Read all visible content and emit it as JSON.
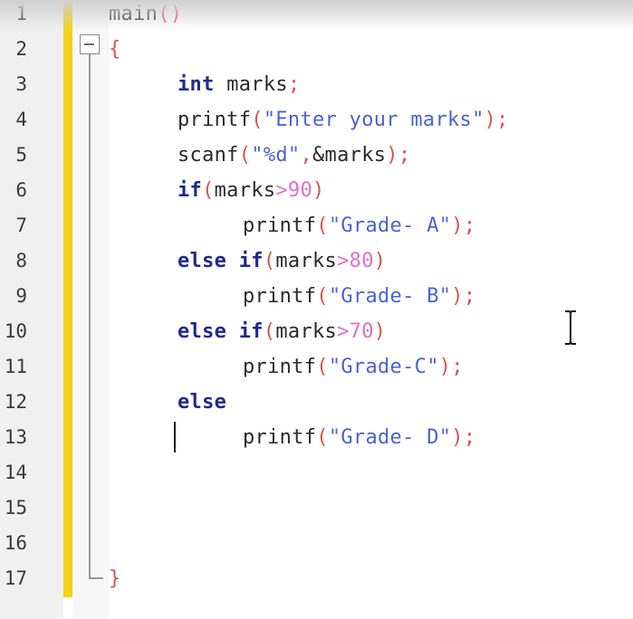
{
  "editor": {
    "line_numbers": [
      "1",
      "2",
      "3",
      "4",
      "5",
      "6",
      "7",
      "8",
      "9",
      "10",
      "11",
      "12",
      "13",
      "14",
      "15",
      "16",
      "17"
    ],
    "code": [
      {
        "line": "1",
        "tokens": [
          {
            "t": "id",
            "v": "main"
          },
          {
            "t": "punc",
            "v": "()"
          }
        ]
      },
      {
        "line": "2",
        "tokens": [
          {
            "t": "punc",
            "v": "{"
          }
        ]
      },
      {
        "line": "3",
        "tokens": [
          {
            "t": "kw",
            "v": "int "
          },
          {
            "t": "id",
            "v": "marks"
          },
          {
            "t": "punc",
            "v": ";"
          }
        ]
      },
      {
        "line": "4",
        "tokens": [
          {
            "t": "id",
            "v": "printf"
          },
          {
            "t": "punc",
            "v": "("
          },
          {
            "t": "str",
            "v": "\"Enter your marks\""
          },
          {
            "t": "punc",
            "v": ");"
          }
        ]
      },
      {
        "line": "5",
        "tokens": [
          {
            "t": "id",
            "v": "scanf"
          },
          {
            "t": "punc",
            "v": "("
          },
          {
            "t": "str",
            "v": "\"%d\""
          },
          {
            "t": "punc",
            "v": ","
          },
          {
            "t": "id",
            "v": "&marks"
          },
          {
            "t": "punc",
            "v": ");"
          }
        ]
      },
      {
        "line": "6",
        "tokens": [
          {
            "t": "kw",
            "v": "if"
          },
          {
            "t": "punc",
            "v": "("
          },
          {
            "t": "id",
            "v": "marks"
          },
          {
            "t": "op",
            "v": ">"
          },
          {
            "t": "num",
            "v": "90"
          },
          {
            "t": "punc",
            "v": ")"
          }
        ]
      },
      {
        "line": "7",
        "tokens": [
          {
            "t": "id",
            "v": "printf"
          },
          {
            "t": "punc",
            "v": "("
          },
          {
            "t": "str",
            "v": "\"Grade- A\""
          },
          {
            "t": "punc",
            "v": ");"
          }
        ]
      },
      {
        "line": "8",
        "tokens": [
          {
            "t": "kw",
            "v": "else if"
          },
          {
            "t": "punc",
            "v": "("
          },
          {
            "t": "id",
            "v": "marks"
          },
          {
            "t": "op",
            "v": ">"
          },
          {
            "t": "num",
            "v": "80"
          },
          {
            "t": "punc",
            "v": ")"
          }
        ]
      },
      {
        "line": "9",
        "tokens": [
          {
            "t": "id",
            "v": "printf"
          },
          {
            "t": "punc",
            "v": "("
          },
          {
            "t": "str",
            "v": "\"Grade- B\""
          },
          {
            "t": "punc",
            "v": ");"
          }
        ]
      },
      {
        "line": "10",
        "tokens": [
          {
            "t": "kw",
            "v": "else if"
          },
          {
            "t": "punc",
            "v": "("
          },
          {
            "t": "id",
            "v": "marks"
          },
          {
            "t": "op",
            "v": ">"
          },
          {
            "t": "num",
            "v": "70"
          },
          {
            "t": "punc",
            "v": ")"
          }
        ]
      },
      {
        "line": "11",
        "tokens": [
          {
            "t": "id",
            "v": "printf"
          },
          {
            "t": "punc",
            "v": "("
          },
          {
            "t": "str",
            "v": "\"Grade-C\""
          },
          {
            "t": "punc",
            "v": ");"
          }
        ]
      },
      {
        "line": "12",
        "tokens": [
          {
            "t": "kw",
            "v": "else"
          }
        ]
      },
      {
        "line": "13",
        "tokens": [
          {
            "t": "id",
            "v": "printf"
          },
          {
            "t": "punc",
            "v": "("
          },
          {
            "t": "str",
            "v": "\"Grade- D\""
          },
          {
            "t": "punc",
            "v": ");"
          }
        ]
      },
      {
        "line": "14",
        "tokens": []
      },
      {
        "line": "15",
        "tokens": []
      },
      {
        "line": "16",
        "tokens": []
      },
      {
        "line": "17",
        "tokens": [
          {
            "t": "punc",
            "v": "}"
          }
        ]
      }
    ]
  },
  "colors": {
    "keyword": "#1f2b8a",
    "string": "#4a63d6",
    "number": "#e070d0",
    "punctuation": "#e05050",
    "change_bar": "#f2d21a"
  },
  "icons": {
    "fold": "fold-collapse-icon",
    "cursor": "i-beam-cursor-icon"
  }
}
